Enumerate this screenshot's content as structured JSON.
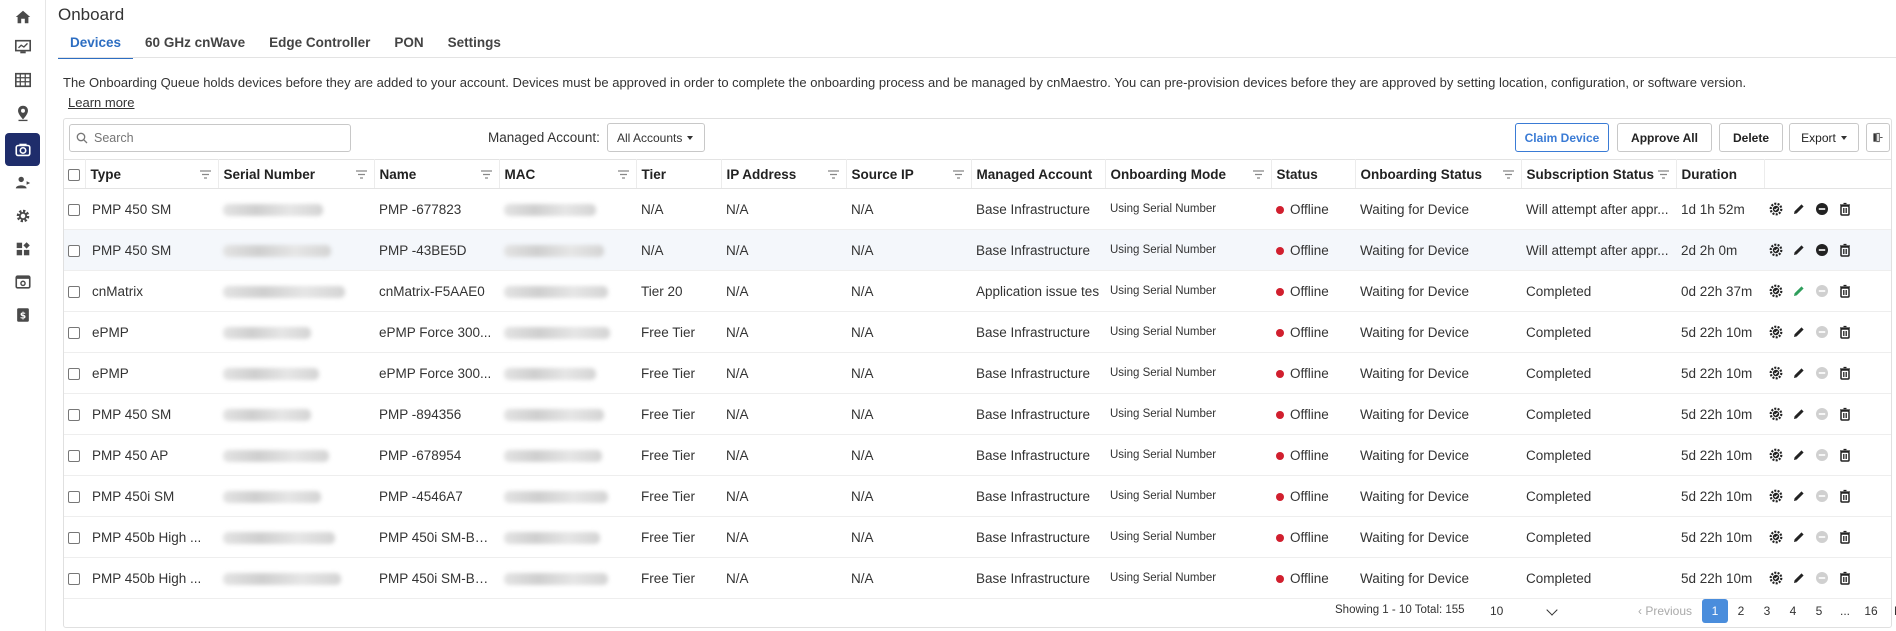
{
  "page": {
    "title": "Onboard",
    "tabs": [
      "Devices",
      "60 GHz cnWave",
      "Edge Controller",
      "PON",
      "Settings"
    ],
    "active_tab": "Devices",
    "info_text": "The Onboarding Queue holds devices before they are added to your account. Devices must be approved in order to complete the onboarding process and be managed by cnMaestro. You can pre-provision devices before they are approved by setting location, configuration, or software version.",
    "learn_more": "Learn more"
  },
  "toolbar": {
    "search_placeholder": "Search",
    "managed_account_label": "Managed Account:",
    "managed_account_value": "All Accounts",
    "claim_device": "Claim Device",
    "approve_all": "Approve All",
    "delete": "Delete",
    "export": "Export",
    "column_toggle_icon": "columns-icon"
  },
  "table": {
    "columns": [
      "Type",
      "Serial Number",
      "Name",
      "MAC",
      "Tier",
      "IP Address",
      "Source IP",
      "Managed Account",
      "Onboarding Mode",
      "Status",
      "Onboarding Status",
      "Subscription Status",
      "Duration"
    ],
    "rows": [
      {
        "type": "PMP 450 SM",
        "name": "PMP -677823",
        "tier": "N/A",
        "ip": "N/A",
        "source_ip": "N/A",
        "account": "Base Infrastructure",
        "mode": "Using Serial Number",
        "status": "Offline",
        "onboarding_status": "Waiting for Device",
        "subscription": "Will attempt after appr...",
        "duration": "1d 1h 52m"
      },
      {
        "type": "PMP 450 SM",
        "name": "PMP -43BE5D",
        "tier": "N/A",
        "ip": "N/A",
        "source_ip": "N/A",
        "account": "Base Infrastructure",
        "mode": "Using Serial Number",
        "status": "Offline",
        "onboarding_status": "Waiting for Device",
        "subscription": "Will attempt after appr...",
        "duration": "2d 2h 0m"
      },
      {
        "type": "cnMatrix",
        "name": "cnMatrix-F5AAE0",
        "tier": "Tier 20",
        "ip": "N/A",
        "source_ip": "N/A",
        "account": "Application issue tes",
        "mode": "Using Serial Number",
        "status": "Offline",
        "onboarding_status": "Waiting for Device",
        "subscription": "Completed",
        "duration": "0d 22h 37m"
      },
      {
        "type": "ePMP",
        "name": "ePMP Force 300...",
        "tier": "Free Tier",
        "ip": "N/A",
        "source_ip": "N/A",
        "account": "Base Infrastructure",
        "mode": "Using Serial Number",
        "status": "Offline",
        "onboarding_status": "Waiting for Device",
        "subscription": "Completed",
        "duration": "5d 22h 10m"
      },
      {
        "type": "ePMP",
        "name": "ePMP Force 300...",
        "tier": "Free Tier",
        "ip": "N/A",
        "source_ip": "N/A",
        "account": "Base Infrastructure",
        "mode": "Using Serial Number",
        "status": "Offline",
        "onboarding_status": "Waiting for Device",
        "subscription": "Completed",
        "duration": "5d 22h 10m"
      },
      {
        "type": "PMP 450 SM",
        "name": "PMP -894356",
        "tier": "Free Tier",
        "ip": "N/A",
        "source_ip": "N/A",
        "account": "Base Infrastructure",
        "mode": "Using Serial Number",
        "status": "Offline",
        "onboarding_status": "Waiting for Device",
        "subscription": "Completed",
        "duration": "5d 22h 10m"
      },
      {
        "type": "PMP 450 AP",
        "name": "PMP -678954",
        "tier": "Free Tier",
        "ip": "N/A",
        "source_ip": "N/A",
        "account": "Base Infrastructure",
        "mode": "Using Serial Number",
        "status": "Offline",
        "onboarding_status": "Waiting for Device",
        "subscription": "Completed",
        "duration": "5d 22h 10m"
      },
      {
        "type": "PMP 450i SM",
        "name": "PMP -4546A7",
        "tier": "Free Tier",
        "ip": "N/A",
        "source_ip": "N/A",
        "account": "Base Infrastructure",
        "mode": "Using Serial Number",
        "status": "Offline",
        "onboarding_status": "Waiting for Device",
        "subscription": "Completed",
        "duration": "5d 22h 10m"
      },
      {
        "type": "PMP 450b High ...",
        "name": "PMP 450i SM-BE...",
        "tier": "Free Tier",
        "ip": "N/A",
        "source_ip": "N/A",
        "account": "Base Infrastructure",
        "mode": "Using Serial Number",
        "status": "Offline",
        "onboarding_status": "Waiting for Device",
        "subscription": "Completed",
        "duration": "5d 22h 10m"
      },
      {
        "type": "PMP 450b High ...",
        "name": "PMP 450i SM-BE...",
        "tier": "Free Tier",
        "ip": "N/A",
        "source_ip": "N/A",
        "account": "Base Infrastructure",
        "mode": "Using Serial Number",
        "status": "Offline",
        "onboarding_status": "Waiting for Device",
        "subscription": "Completed",
        "duration": "5d 22h 10m"
      }
    ]
  },
  "footer": {
    "showing": "Showing 1 - 10 Total: 155",
    "page_size": "10",
    "previous": "‹ Previous",
    "pages": [
      "1",
      "2",
      "3",
      "4",
      "5",
      "...",
      "16"
    ],
    "current_page": "1",
    "next": "Next ›"
  },
  "colors": {
    "sidebar_active": "#1f2d6b",
    "accent": "#2d6ec2",
    "status_offline": "#d11f2e"
  }
}
